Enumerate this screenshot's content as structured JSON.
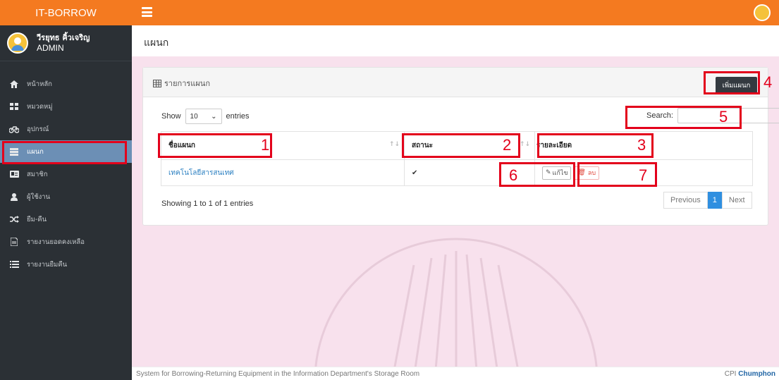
{
  "app": {
    "brand": "IT-BORROW"
  },
  "user": {
    "name": "วีรยุทธ คิ้วเจริญ",
    "role": "ADMIN"
  },
  "sidebar": {
    "items": [
      {
        "label": "หน้าหลัก",
        "icon": "home-icon"
      },
      {
        "label": "หมวดหมู่",
        "icon": "grid-icon"
      },
      {
        "label": "อุปกรณ์",
        "icon": "bicycle-icon"
      },
      {
        "label": "แผนก",
        "icon": "table-icon",
        "active": true
      },
      {
        "label": "สมาชิก",
        "icon": "id-card-icon"
      },
      {
        "label": "ผู้ใช้งาน",
        "icon": "user-icon"
      },
      {
        "label": "ยืม-คืน",
        "icon": "shuffle-icon"
      },
      {
        "label": "รายงานยอดคงเหลือ",
        "icon": "document-icon"
      },
      {
        "label": "รายงานยืมคืน",
        "icon": "list-icon"
      }
    ]
  },
  "page": {
    "title": "แผนก"
  },
  "card": {
    "title": "รายการแผนก",
    "add_button": "เพิ่มแผนก"
  },
  "controls": {
    "show_label": "Show",
    "page_size": "10",
    "entries_label": "entries",
    "search_label": "Search:"
  },
  "table": {
    "headers": [
      "ชื่อแผนก",
      "สถานะ",
      "รายละเอียด"
    ],
    "rows": [
      {
        "name": "เทคโนโลยีสารสนเทศ",
        "status": "✔",
        "edit": "แก้ไข",
        "delete": "ลบ"
      }
    ]
  },
  "info": "Showing 1 to 1 of 1 entries",
  "pager": {
    "previous": "Previous",
    "current": "1",
    "next": "Next"
  },
  "footer": {
    "text": "System for Borrowing-Returning Equipment in the Information Department's Storage Room",
    "right_prefix": "CPI",
    "right_strong": "Chumphon"
  },
  "annotations": [
    "1",
    "2",
    "3",
    "4",
    "5",
    "6",
    "7"
  ],
  "colors": {
    "accent": "#f47a20",
    "sidebar": "#2b3035",
    "annotation": "#e3001b"
  }
}
